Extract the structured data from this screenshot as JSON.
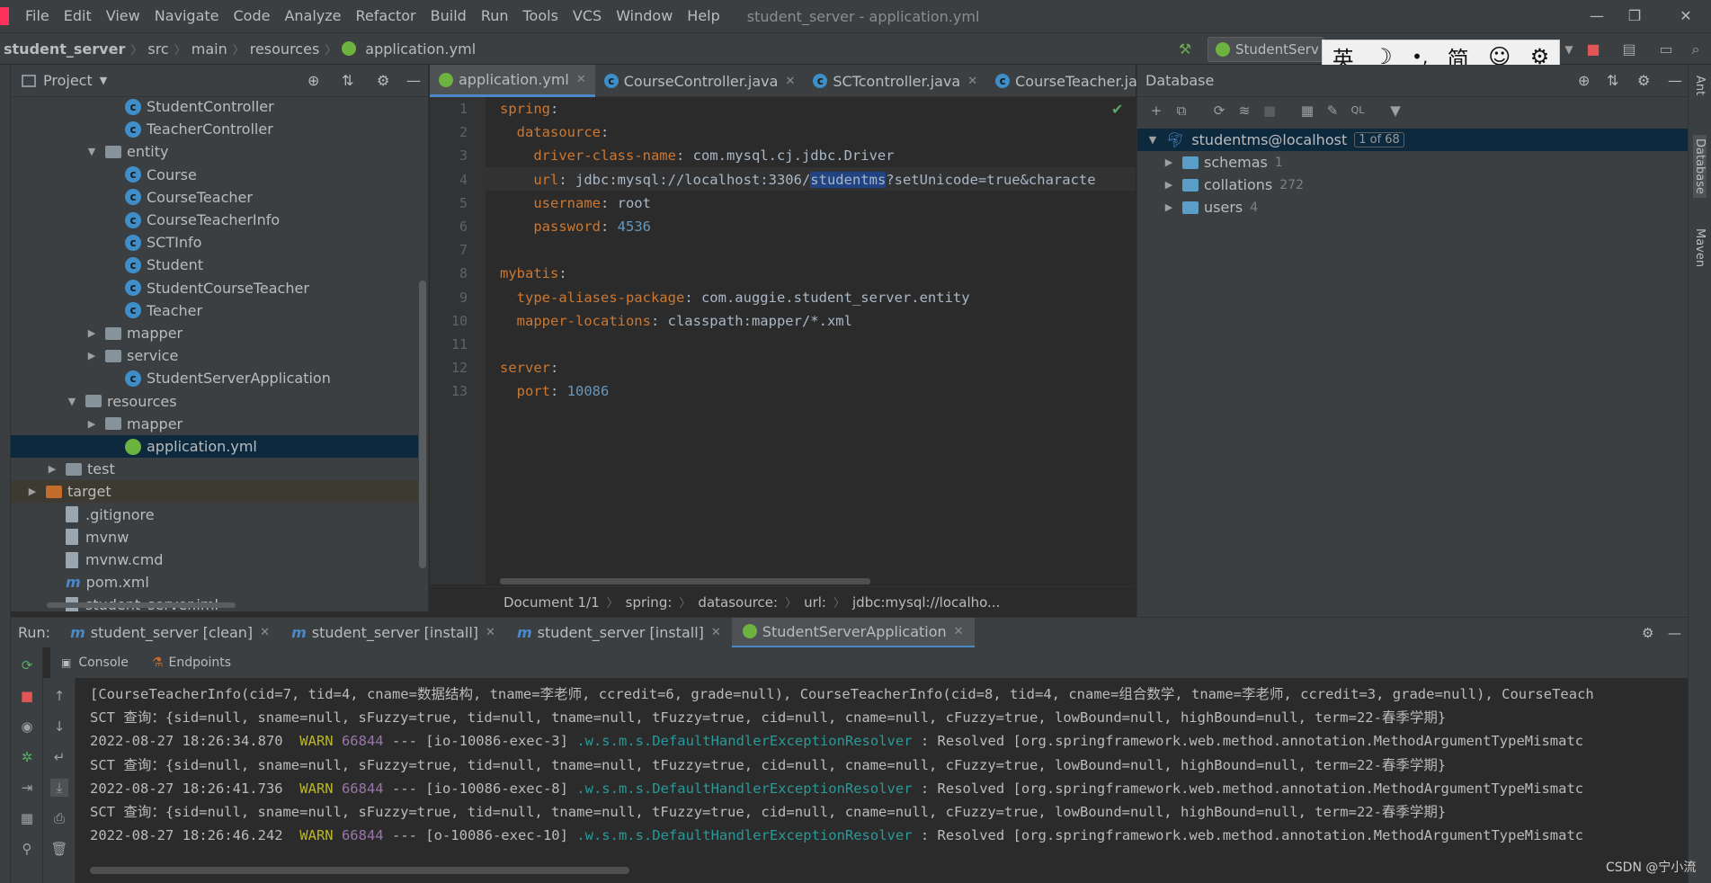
{
  "menubar": {
    "items": [
      "File",
      "Edit",
      "View",
      "Navigate",
      "Code",
      "Analyze",
      "Refactor",
      "Build",
      "Run",
      "Tools",
      "VCS",
      "Window",
      "Help"
    ],
    "window_title": "student_server - application.yml"
  },
  "navbar": {
    "crumbs": [
      "student_server",
      "src",
      "main",
      "resources",
      "application.yml"
    ],
    "run_config": "StudentServ"
  },
  "ime": {
    "lang": "英",
    "moon": "☽",
    "punct": "•,",
    "simp": "简",
    "emoji": "☺",
    "gear": "⚙"
  },
  "project": {
    "title": "Project",
    "tree": [
      {
        "label": "StudentController",
        "kind": "class",
        "indent": 5,
        "chev": ""
      },
      {
        "label": "TeacherController",
        "kind": "class",
        "indent": 5,
        "chev": ""
      },
      {
        "label": "entity",
        "kind": "package",
        "indent": 4,
        "chev": "down"
      },
      {
        "label": "Course",
        "kind": "class",
        "indent": 5,
        "chev": ""
      },
      {
        "label": "CourseTeacher",
        "kind": "class",
        "indent": 5,
        "chev": ""
      },
      {
        "label": "CourseTeacherInfo",
        "kind": "class",
        "indent": 5,
        "chev": ""
      },
      {
        "label": "SCTInfo",
        "kind": "class",
        "indent": 5,
        "chev": ""
      },
      {
        "label": "Student",
        "kind": "class",
        "indent": 5,
        "chev": ""
      },
      {
        "label": "StudentCourseTeacher",
        "kind": "class",
        "indent": 5,
        "chev": ""
      },
      {
        "label": "Teacher",
        "kind": "class",
        "indent": 5,
        "chev": ""
      },
      {
        "label": "mapper",
        "kind": "package",
        "indent": 4,
        "chev": "right"
      },
      {
        "label": "service",
        "kind": "package",
        "indent": 4,
        "chev": "right"
      },
      {
        "label": "StudentServerApplication",
        "kind": "springclass",
        "indent": 5,
        "chev": ""
      },
      {
        "label": "resources",
        "kind": "folder",
        "indent": 3,
        "chev": "down"
      },
      {
        "label": "mapper",
        "kind": "folder",
        "indent": 4,
        "chev": "right"
      },
      {
        "label": "application.yml",
        "kind": "yml",
        "indent": 5,
        "chev": ""
      },
      {
        "label": "test",
        "kind": "folder",
        "indent": 2,
        "chev": "right"
      },
      {
        "label": "target",
        "kind": "orangefolder",
        "indent": 1,
        "chev": "right"
      },
      {
        "label": ".gitignore",
        "kind": "file",
        "indent": 2,
        "chev": ""
      },
      {
        "label": "mvnw",
        "kind": "file",
        "indent": 2,
        "chev": ""
      },
      {
        "label": "mvnw.cmd",
        "kind": "file",
        "indent": 2,
        "chev": ""
      },
      {
        "label": "pom.xml",
        "kind": "maven",
        "indent": 2,
        "chev": ""
      },
      {
        "label": "student_server.iml",
        "kind": "file",
        "indent": 2,
        "chev": ""
      }
    ]
  },
  "editor_tabs": [
    {
      "label": "application.yml",
      "active": true
    },
    {
      "label": "CourseController.java",
      "active": false
    },
    {
      "label": "SCTcontroller.java",
      "active": false
    },
    {
      "label": "CourseTeacher.ja",
      "active": false
    }
  ],
  "editor": {
    "line_numbers": [
      "1",
      "2",
      "3",
      "4",
      "5",
      "6",
      "7",
      "8",
      "9",
      "10",
      "11",
      "12",
      "13"
    ],
    "lines": [
      [
        {
          "t": "spring",
          "c": "k"
        },
        {
          "t": ":",
          "c": "v"
        }
      ],
      [
        {
          "t": "  datasource",
          "c": "k"
        },
        {
          "t": ":",
          "c": "v"
        }
      ],
      [
        {
          "t": "    driver-class-name",
          "c": "k"
        },
        {
          "t": ": com.mysql.cj.jdbc.Driver",
          "c": "v"
        }
      ],
      [
        {
          "t": "    url",
          "c": "k"
        },
        {
          "t": ": jdbc:mysql://localhost:3306/",
          "c": "v"
        },
        {
          "t": "studentms",
          "c": "v hl"
        },
        {
          "t": "?setUnicode=true&characte",
          "c": "v"
        }
      ],
      [
        {
          "t": "    username",
          "c": "k"
        },
        {
          "t": ": root",
          "c": "v"
        }
      ],
      [
        {
          "t": "    password",
          "c": "k"
        },
        {
          "t": ": ",
          "c": "v"
        },
        {
          "t": "4536",
          "c": "n"
        }
      ],
      [],
      [
        {
          "t": "mybatis",
          "c": "k"
        },
        {
          "t": ":",
          "c": "v"
        }
      ],
      [
        {
          "t": "  type-aliases-package",
          "c": "k"
        },
        {
          "t": ": com.auggie.student_server.entity",
          "c": "v"
        }
      ],
      [
        {
          "t": "  mapper-locations",
          "c": "k"
        },
        {
          "t": ": classpath:mapper/*.xml",
          "c": "v"
        }
      ],
      [],
      [
        {
          "t": "server",
          "c": "k"
        },
        {
          "t": ":",
          "c": "v"
        }
      ],
      [
        {
          "t": "  port",
          "c": "k"
        },
        {
          "t": ": ",
          "c": "v"
        },
        {
          "t": "10086",
          "c": "n"
        }
      ]
    ],
    "breadcrumb": [
      "Document 1/1",
      "spring:",
      "datasource:",
      "url:",
      "jdbc:mysql://localho..."
    ]
  },
  "database": {
    "title": "Database",
    "root": {
      "label": "studentms@localhost",
      "badge": "1 of 68"
    },
    "children": [
      {
        "label": "schemas",
        "count": "1"
      },
      {
        "label": "collations",
        "count": "272"
      },
      {
        "label": "users",
        "count": "4"
      }
    ]
  },
  "right_stripe": [
    "Ant",
    "Database",
    "Maven"
  ],
  "run": {
    "label": "Run:",
    "tabs": [
      {
        "label": "student_server [clean]",
        "active": false
      },
      {
        "label": "student_server [install]",
        "active": false
      },
      {
        "label": "student_server [install]",
        "active": false
      },
      {
        "label": "StudentServerApplication",
        "active": true
      }
    ],
    "subtabs": [
      "Console",
      "Endpoints"
    ],
    "console": [
      [
        {
          "t": "[CourseTeacherInfo(cid=7, tid=4, cname=数据结构, tname=李老师, ccredit=6, grade=null), CourseTeacherInfo(cid=8, tid=4, cname=组合数学, tname=李老师, ccredit=3, grade=null), CourseTeach",
          "c": ""
        }
      ],
      [
        {
          "t": "SCT 查询：{sid=null, sname=null, sFuzzy=true, tid=null, tname=null, tFuzzy=true, cid=null, cname=null, cFuzzy=true, lowBound=null, highBound=null, term=22-春季学期}",
          "c": ""
        }
      ],
      [
        {
          "t": "2022-08-27 18:26:34.870  ",
          "c": ""
        },
        {
          "t": "WARN",
          "c": "warn"
        },
        {
          "t": " ",
          "c": ""
        },
        {
          "t": "66844",
          "c": "pid"
        },
        {
          "t": " --- [io-10086-exec-3] ",
          "c": ""
        },
        {
          "t": ".w.s.m.s.DefaultHandlerExceptionResolver",
          "c": "cls"
        },
        {
          "t": " : Resolved [org.springframework.web.method.annotation.MethodArgumentTypeMismatc",
          "c": ""
        }
      ],
      [
        {
          "t": "SCT 查询：{sid=null, sname=null, sFuzzy=true, tid=null, tname=null, tFuzzy=true, cid=null, cname=null, cFuzzy=true, lowBound=null, highBound=null, term=22-春季学期}",
          "c": ""
        }
      ],
      [
        {
          "t": "2022-08-27 18:26:41.736  ",
          "c": ""
        },
        {
          "t": "WARN",
          "c": "warn"
        },
        {
          "t": " ",
          "c": ""
        },
        {
          "t": "66844",
          "c": "pid"
        },
        {
          "t": " --- [io-10086-exec-8] ",
          "c": ""
        },
        {
          "t": ".w.s.m.s.DefaultHandlerExceptionResolver",
          "c": "cls"
        },
        {
          "t": " : Resolved [org.springframework.web.method.annotation.MethodArgumentTypeMismatc",
          "c": ""
        }
      ],
      [
        {
          "t": "SCT 查询：{sid=null, sname=null, sFuzzy=true, tid=null, tname=null, tFuzzy=true, cid=null, cname=null, cFuzzy=true, lowBound=null, highBound=null, term=22-春季学期}",
          "c": ""
        }
      ],
      [
        {
          "t": "2022-08-27 18:26:46.242  ",
          "c": ""
        },
        {
          "t": "WARN",
          "c": "warn"
        },
        {
          "t": " ",
          "c": ""
        },
        {
          "t": "66844",
          "c": "pid"
        },
        {
          "t": " --- [o-10086-exec-10] ",
          "c": ""
        },
        {
          "t": ".w.s.m.s.DefaultHandlerExceptionResolver",
          "c": "cls"
        },
        {
          "t": " : Resolved [org.springframework.web.method.annotation.MethodArgumentTypeMismatc",
          "c": ""
        }
      ]
    ]
  },
  "watermark": "CSDN @宁小流",
  "colors": {
    "accent": "#4a88c7",
    "keyword": "#cc7832",
    "number": "#6897bb",
    "warn": "#bbb529",
    "class": "#299999",
    "selection": "#0d293e"
  }
}
